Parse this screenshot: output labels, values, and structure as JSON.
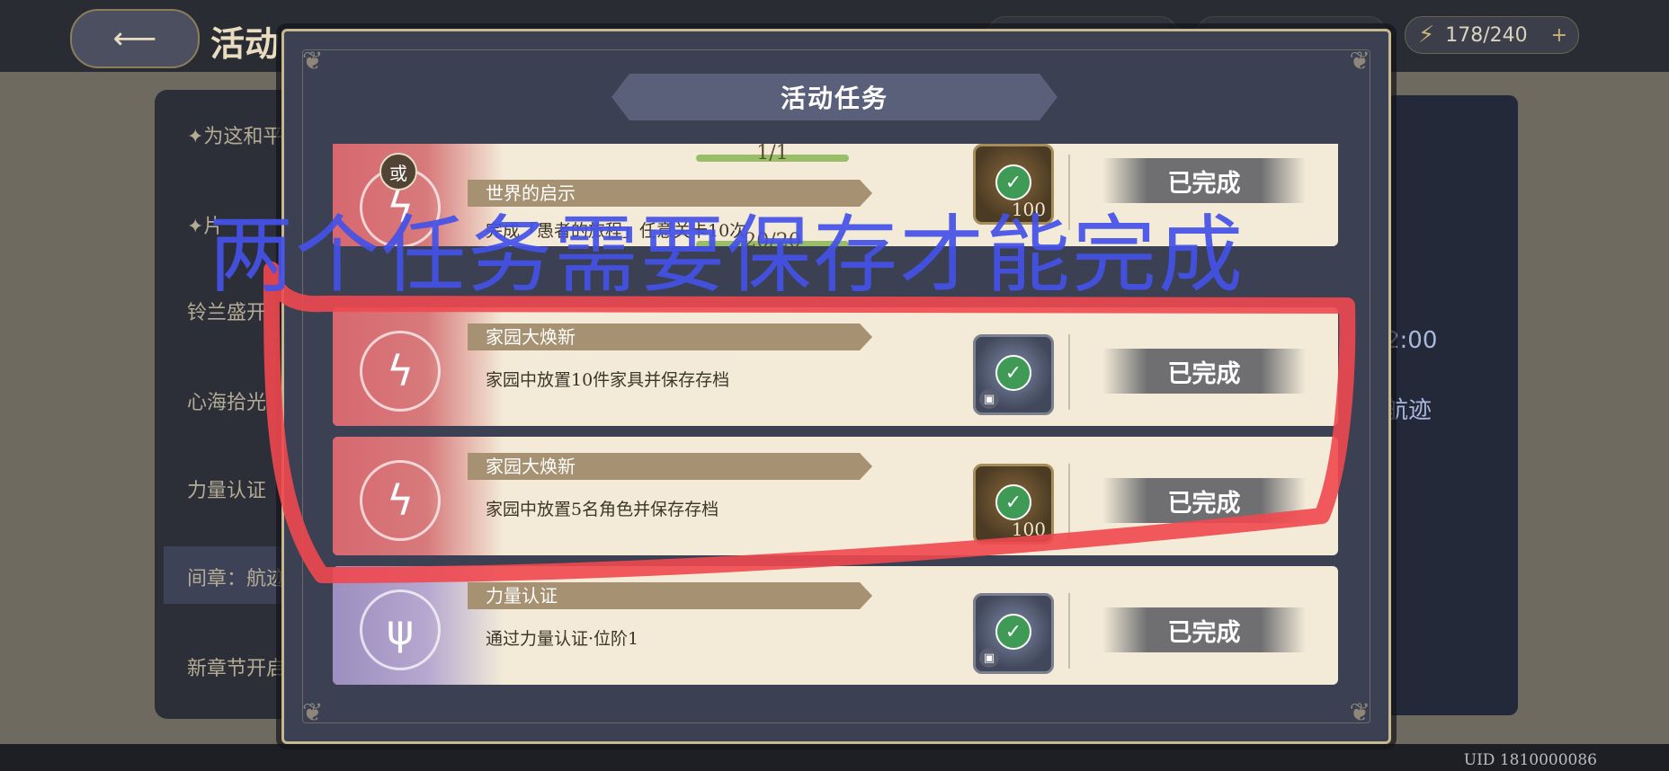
{
  "background": {
    "title": "活动",
    "energy": "178/240",
    "side_items": [
      "✦为这和平的",
      "✦片",
      "铃兰盛开",
      "心海拾光",
      "力量认证",
      "间章：航迹",
      "新章节开启"
    ],
    "right_texts": [
      "2:00",
      "航迹"
    ],
    "uid": "UID 1810000086"
  },
  "modal": {
    "title": "活动任务",
    "rows": [
      {
        "name": "世界的启示",
        "desc": "完成「愚者的旅程」任意关卡10次",
        "progress_top": "1/1",
        "progress_bottom": "20/20",
        "or_label": "或",
        "reward_qty": "100",
        "status": "已完成",
        "theme": "red"
      },
      {
        "name": "家园大焕新",
        "desc": "家园中放置10件家具并保存存档",
        "reward_qty": "",
        "status": "已完成",
        "theme": "red"
      },
      {
        "name": "家园大焕新",
        "desc": "家园中放置5名角色并保存存档",
        "reward_qty": "100",
        "status": "已完成",
        "theme": "red"
      },
      {
        "name": "力量认证",
        "desc": "通过力量认证·位阶1",
        "reward_qty": "",
        "status": "已完成",
        "theme": "purple"
      }
    ]
  },
  "annotation": {
    "text": "两个任务需要保存才能完成",
    "color": "#4452e8",
    "mark_color": "#f0484f"
  },
  "icons": {
    "back": "back-arrow-icon",
    "energy": "lightning-icon",
    "check": "check-icon",
    "emblem": "lightning-emblem-icon",
    "lock": "lock-icon"
  }
}
